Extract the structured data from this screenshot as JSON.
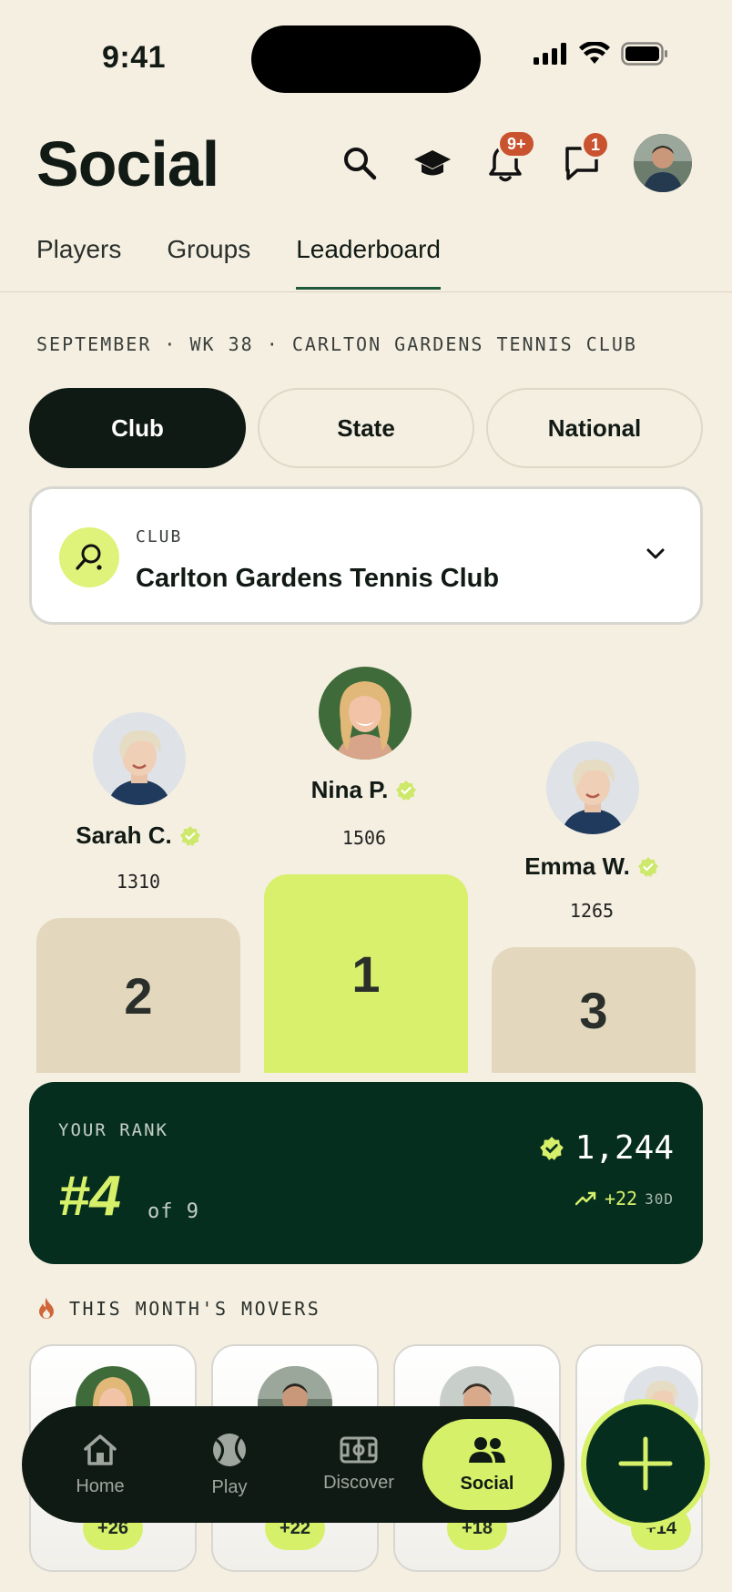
{
  "status_bar": {
    "time": "9:41"
  },
  "header": {
    "title": "Social",
    "notifications_badge": "9+",
    "messages_badge": "1"
  },
  "tabs": [
    {
      "label": "Players"
    },
    {
      "label": "Groups"
    },
    {
      "label": "Leaderboard"
    }
  ],
  "section_meta": "SEPTEMBER · WK 38 · CARLTON GARDENS TENNIS CLUB",
  "segments": [
    {
      "label": "Club"
    },
    {
      "label": "State"
    },
    {
      "label": "National"
    }
  ],
  "club_selector": {
    "label": "CLUB",
    "name": "Carlton Gardens Tennis Club"
  },
  "podium": [
    {
      "rank": "2",
      "name": "Sarah C.",
      "score": "1310"
    },
    {
      "rank": "1",
      "name": "Nina P.",
      "score": "1506"
    },
    {
      "rank": "3",
      "name": "Emma W.",
      "score": "1265"
    }
  ],
  "your_rank": {
    "label": "YOUR RANK",
    "rank": "#4",
    "of": "of 9",
    "score": "1,244",
    "delta": "+22",
    "period": "30D"
  },
  "movers": {
    "title": "THIS MONTH'S MOVERS",
    "items": [
      {
        "delta": "+26"
      },
      {
        "delta": "+22"
      },
      {
        "delta": "+18"
      },
      {
        "delta": "+14"
      }
    ]
  },
  "bottom_nav": [
    {
      "label": "Home",
      "icon": "home-icon"
    },
    {
      "label": "Play",
      "icon": "tennis-ball-icon"
    },
    {
      "label": "Discover",
      "icon": "court-icon"
    },
    {
      "label": "Social",
      "icon": "people-icon"
    }
  ],
  "colors": {
    "background": "#f5efe2",
    "accent": "#d6f06a",
    "dark_green": "#052e1e",
    "badge": "#c9532e"
  }
}
